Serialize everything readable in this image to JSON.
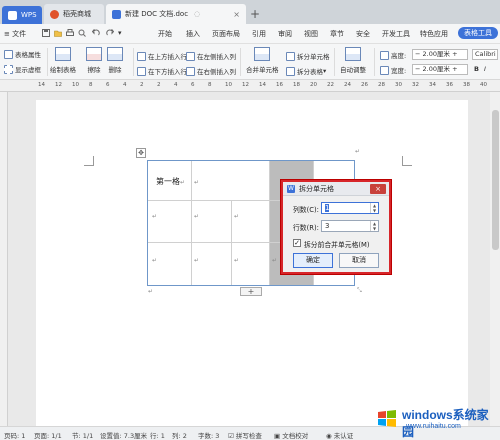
{
  "tabs": [
    {
      "label": "WPS"
    },
    {
      "label": "稻壳商城"
    },
    {
      "label": "新建 DOC 文档.doc"
    }
  ],
  "menubar": {
    "file": "文件",
    "items": [
      "开始",
      "插入",
      "页面布局",
      "引用",
      "审阅",
      "视图",
      "章节",
      "安全",
      "开发工具",
      "特色应用"
    ],
    "active": "表格工具"
  },
  "ribbon": {
    "table_props": "表格属性",
    "show_gridlines": "显示虚框",
    "draw_table": "绘制表格",
    "erase": "擦除",
    "delete": "删除",
    "insert_above": "在上方插入行",
    "insert_below": "在下方插入行",
    "insert_left": "在左侧插入列",
    "insert_right": "在右侧插入列",
    "merge_cells": "合并单元格",
    "split_cells": "拆分单元格",
    "split_table": "拆分表格",
    "auto_fit": "自动调整",
    "height_label": "高度:",
    "height_value": "2.00厘米",
    "width_label": "宽度:",
    "width_value": "2.00厘米",
    "font": "Calibri"
  },
  "ruler_numbers": [
    "14",
    "12",
    "10",
    "8",
    "6",
    "4",
    "2",
    "2",
    "4",
    "6",
    "8",
    "10",
    "12",
    "14",
    "16",
    "18",
    "20",
    "22",
    "24",
    "26",
    "28",
    "30",
    "32",
    "34",
    "36",
    "38",
    "40"
  ],
  "document": {
    "cell_text": "第一格",
    "para_mark": "↵"
  },
  "dialog": {
    "title": "拆分单元格",
    "cols_label": "列数(C):",
    "cols_value": "1",
    "rows_label": "行数(R):",
    "rows_value": "3",
    "merge_label": "拆分前合并单元格(M)",
    "merge_checked": true,
    "ok": "确定",
    "cancel": "取消"
  },
  "statusbar": {
    "page": "页码: 1",
    "pages": "页面: 1/1",
    "section": "节: 1/1",
    "setting": "设置值: 7.3厘米",
    "row": "行: 1",
    "col": "列: 2",
    "words": "字数: 3",
    "spell": "拼写检查",
    "doc_check": "文档校对",
    "save": "未认证"
  },
  "watermark": {
    "title": "windows系统家园",
    "url": "www.ruihaitu.com"
  },
  "colors": {
    "accent": "#3d72d8",
    "dialog_border": "#d7262a",
    "table_border": "#6f97c9",
    "selection": "#bcbcbc"
  }
}
